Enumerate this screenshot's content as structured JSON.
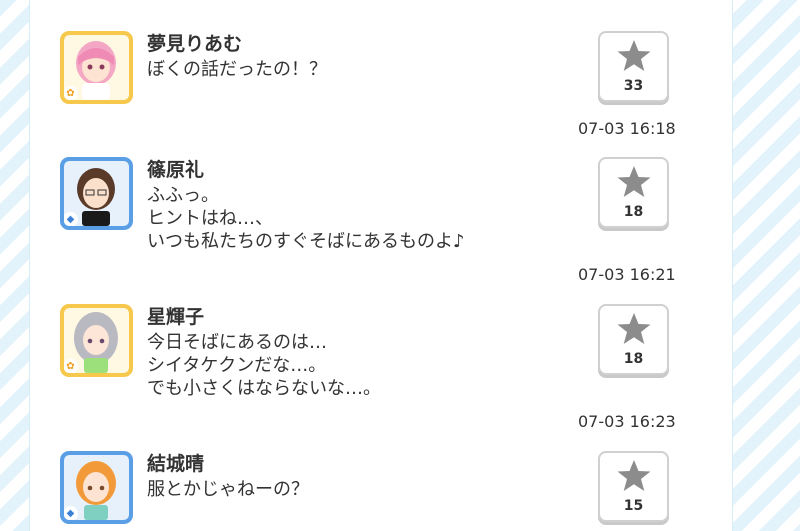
{
  "posts": [
    {
      "name": "夢見りあむ",
      "message": "ぼくの話だったの！？",
      "likes": "33",
      "time": "07-03 16:18",
      "attribute": "cute"
    },
    {
      "name": "篠原礼",
      "message": "ふふっ。\nヒントはね…、\nいつも私たちのすぐそばにあるものよ♪",
      "likes": "18",
      "time": "07-03 16:21",
      "attribute": "cool"
    },
    {
      "name": "星輝子",
      "message": "今日そばにあるのは…\nシイタケクンだな…。\nでも小さくはならないな…。",
      "likes": "18",
      "time": "07-03 16:23",
      "attribute": "cute"
    },
    {
      "name": "結城晴",
      "message": "服とかじゃねーの？",
      "likes": "15",
      "time": "",
      "attribute": "cool"
    }
  ],
  "colors": {
    "cute": "#f6c84b",
    "cool": "#5a9ee6",
    "star": "#8c8c8c"
  },
  "icons": {
    "like": "star-icon",
    "attribute": "attribute-icon"
  }
}
